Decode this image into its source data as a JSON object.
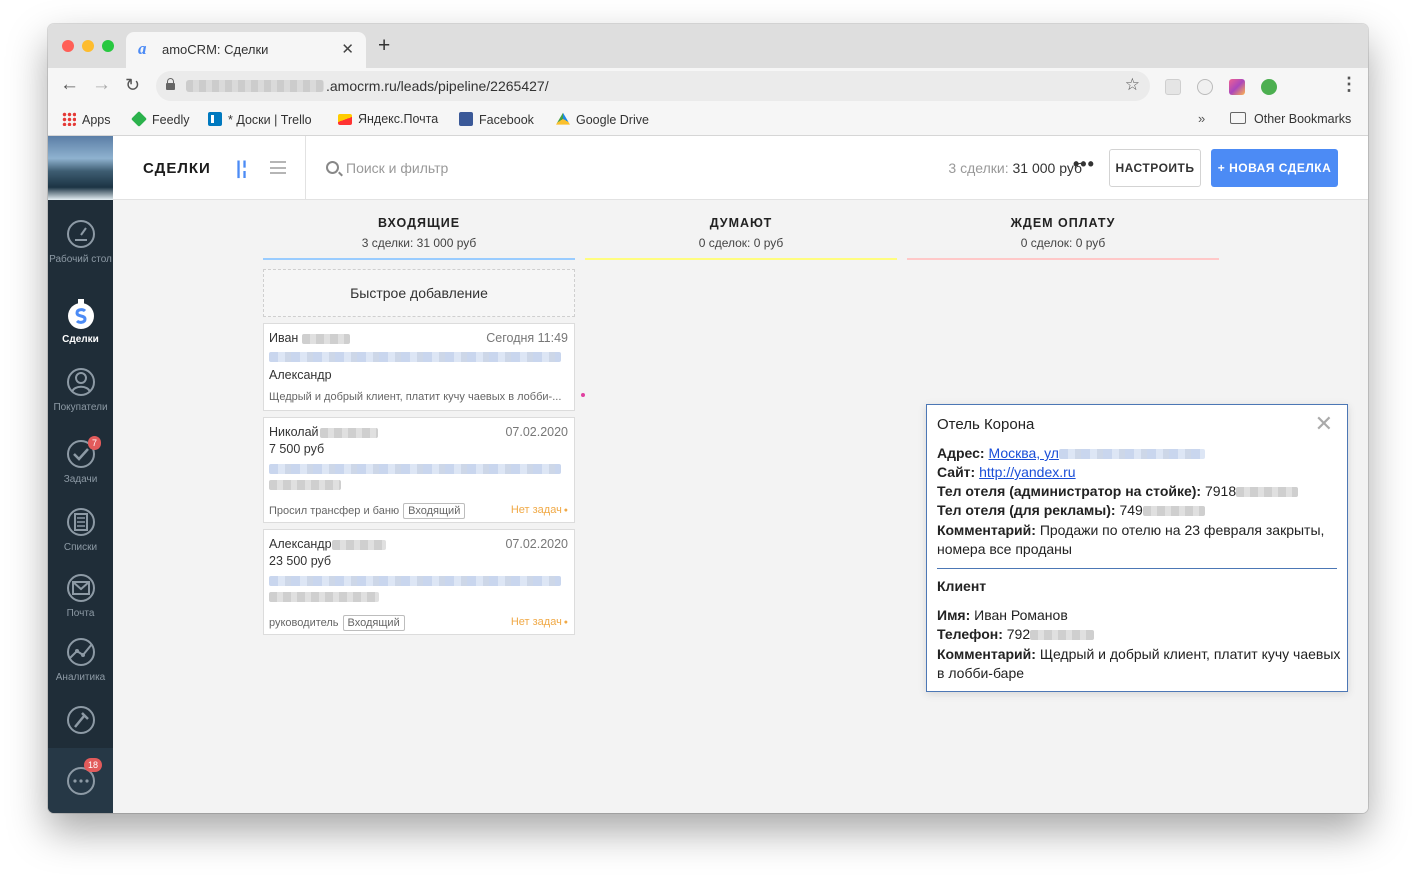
{
  "browser": {
    "tab_title": "amoCRM: Сделки",
    "url": ".amocrm.ru/leads/pipeline/2265427/",
    "bookmarks": [
      "Apps",
      "Feedly",
      "* Доски | Trello",
      "Яндекс.Почта",
      "Facebook",
      "Google Drive"
    ],
    "other_bookmarks": "Other Bookmarks"
  },
  "sidebar": {
    "items": [
      {
        "label": "Рабочий стол",
        "icon": "dashboard-icon"
      },
      {
        "label": "Сделки",
        "icon": "deals-icon"
      },
      {
        "label": "Покупатели",
        "icon": "customers-icon"
      },
      {
        "label": "Задачи",
        "icon": "tasks-icon",
        "badge": "7"
      },
      {
        "label": "Списки",
        "icon": "lists-icon"
      },
      {
        "label": "Почта",
        "icon": "mail-icon"
      },
      {
        "label": "Аналитика",
        "icon": "analytics-icon"
      },
      {
        "label": "",
        "icon": "settings-icon"
      }
    ],
    "chat_badge": "18"
  },
  "header": {
    "title": "СДЕЛКИ",
    "search_placeholder": "Поиск и фильтр",
    "summary_prefix": "3 сделки:",
    "summary_value": "31 000 руб",
    "more": "•••",
    "setup_label": "НАСТРОИТЬ",
    "new_deal_label": "+ НОВАЯ СДЕЛКА"
  },
  "columns": [
    {
      "name": "ВХОДЯЩИЕ",
      "summary": "3 сделки: 31 000 руб",
      "color": "#99ccff"
    },
    {
      "name": "ДУМАЮТ",
      "summary": "0 сделок: 0 руб",
      "color": "#fffd7f"
    },
    {
      "name": "ЖДЕМ ОПЛАТУ",
      "summary": "0 сделок: 0 руб",
      "color": "#ffc8c8"
    }
  ],
  "quick_add": "Быстрое добавление",
  "cards": [
    {
      "name": "Иван",
      "date": "Сегодня 11:49",
      "contact": "Александр",
      "note": "Щедрый и добрый клиент, платит кучу чаевых в лобби-..."
    },
    {
      "name": "Николай",
      "date": "07.02.2020",
      "price": "7 500 руб",
      "note": "Просил трансфер и баню",
      "tag": "Входящий",
      "task": "Нет задач"
    },
    {
      "name": "Александр",
      "date": "07.02.2020",
      "price": "23 500 руб",
      "note": "руководитель",
      "tag": "Входящий",
      "task": "Нет задач"
    }
  ],
  "popup": {
    "title": "Отель Корона",
    "address_label": "Адрес:",
    "address_value": "Москва, ул",
    "site_label": "Сайт:",
    "site_value": "http://yandex.ru",
    "phone_admin_label": "Тел отеля (администратор на стойке):",
    "phone_admin_value": "7918",
    "phone_ads_label": "Тел отеля (для рекламы):",
    "phone_ads_value": "749",
    "comment_label": "Комментарий:",
    "comment_value": "Продажи по отелю на 23 февраля закрыты, номера все проданы",
    "client_heading": "Клиент",
    "name_label": "Имя:",
    "name_value": "Иван Романов",
    "phone_label": "Телефон:",
    "phone_value": "792",
    "client_comment_label": "Комментарий:",
    "client_comment_value": "Щедрый и добрый клиент, платит кучу чаевых в лобби-баре"
  }
}
